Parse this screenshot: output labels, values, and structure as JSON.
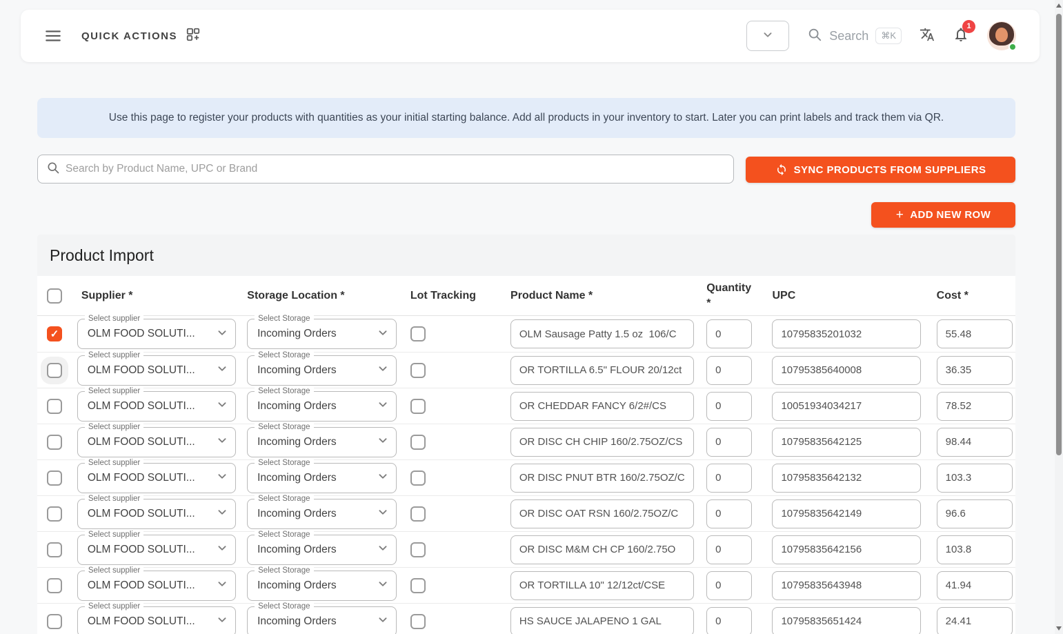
{
  "navbar": {
    "quick_actions_label": "QUICK ACTIONS",
    "search_label": "Search",
    "search_shortcut": "⌘K",
    "notification_count": "1"
  },
  "banner": {
    "text": "Use this page to register your products with quantities as your initial starting balance. Add all products in your inventory to start. Later you can print labels and track them via QR."
  },
  "search": {
    "placeholder": "Search by Product Name, UPC or Brand"
  },
  "buttons": {
    "sync": "SYNC PRODUCTS FROM SUPPLIERS",
    "add_row": "ADD NEW ROW"
  },
  "icons": {
    "plus": "+"
  },
  "colors": {
    "accent": "#f4511e",
    "badge": "#ef4444",
    "banner_bg": "#e3ecf9",
    "online": "#3fae4a"
  },
  "table": {
    "title": "Product Import",
    "headers": {
      "supplier": "Supplier *",
      "storage": "Storage Location *",
      "lot": "Lot Tracking",
      "product": "Product Name *",
      "quantity": "Quantity *",
      "upc": "UPC",
      "cost": "Cost *"
    },
    "select_supplier_label": "Select supplier",
    "select_storage_label": "Select Storage",
    "rows": [
      {
        "selected": true,
        "halo": false,
        "supplier": "OLM FOOD SOLUTI...",
        "storage": "Incoming Orders",
        "lot_tracking": false,
        "product": "OLM Sausage Patty 1.5 oz  106/C",
        "qty": "0",
        "upc": "10795835201032",
        "cost": "55.48"
      },
      {
        "selected": false,
        "halo": true,
        "supplier": "OLM FOOD SOLUTI...",
        "storage": "Incoming Orders",
        "lot_tracking": false,
        "product": "OR TORTILLA 6.5\" FLOUR 20/12ct",
        "qty": "0",
        "upc": "10795385640008",
        "cost": "36.35"
      },
      {
        "selected": false,
        "halo": false,
        "supplier": "OLM FOOD SOLUTI...",
        "storage": "Incoming Orders",
        "lot_tracking": false,
        "product": "OR CHEDDAR FANCY 6/2#/CS",
        "qty": "0",
        "upc": "10051934034217",
        "cost": "78.52"
      },
      {
        "selected": false,
        "halo": false,
        "supplier": "OLM FOOD SOLUTI...",
        "storage": "Incoming Orders",
        "lot_tracking": false,
        "product": "OR DISC CH CHIP 160/2.75OZ/CS",
        "qty": "0",
        "upc": "10795835642125",
        "cost": "98.44"
      },
      {
        "selected": false,
        "halo": false,
        "supplier": "OLM FOOD SOLUTI...",
        "storage": "Incoming Orders",
        "lot_tracking": false,
        "product": "OR DISC PNUT BTR 160/2.75OZ/C",
        "qty": "0",
        "upc": "10795835642132",
        "cost": "103.3"
      },
      {
        "selected": false,
        "halo": false,
        "supplier": "OLM FOOD SOLUTI...",
        "storage": "Incoming Orders",
        "lot_tracking": false,
        "product": "OR DISC OAT RSN 160/2.75OZ/C",
        "qty": "0",
        "upc": "10795835642149",
        "cost": "96.6"
      },
      {
        "selected": false,
        "halo": false,
        "supplier": "OLM FOOD SOLUTI...",
        "storage": "Incoming Orders",
        "lot_tracking": false,
        "product": "OR DISC M&M CH CP 160/2.75O",
        "qty": "0",
        "upc": "10795835642156",
        "cost": "103.8"
      },
      {
        "selected": false,
        "halo": false,
        "supplier": "OLM FOOD SOLUTI...",
        "storage": "Incoming Orders",
        "lot_tracking": false,
        "product": "OR TORTILLA 10\" 12/12ct/CSE",
        "qty": "0",
        "upc": "10795835643948",
        "cost": "41.94"
      },
      {
        "selected": false,
        "halo": false,
        "supplier": "OLM FOOD SOLUTI...",
        "storage": "Incoming Orders",
        "lot_tracking": false,
        "product": "HS SAUCE JALAPENO 1 GAL",
        "qty": "0",
        "upc": "10795835651424",
        "cost": "24.41"
      }
    ]
  }
}
